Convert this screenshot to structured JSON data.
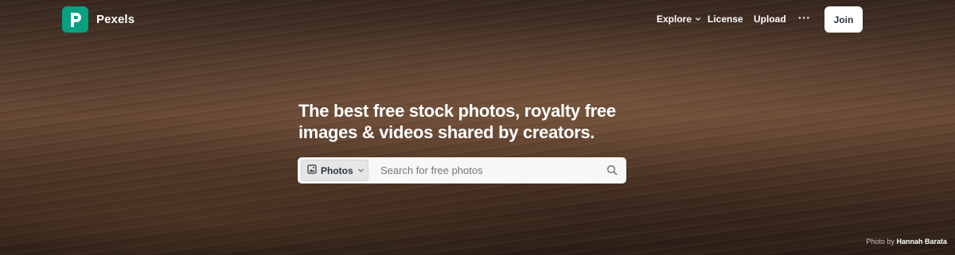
{
  "brand": {
    "name": "Pexels",
    "logo_letter_icon": "pexels-logo-icon",
    "accent": "#07a081"
  },
  "nav": {
    "explore_label": "Explore",
    "license_label": "License",
    "upload_label": "Upload",
    "more_label": "···",
    "join_label": "Join"
  },
  "hero": {
    "headline_line1": "The best free stock photos, royalty free",
    "headline_line2": "images & videos shared by creators."
  },
  "search": {
    "type_label": "Photos",
    "placeholder": "Search for free photos",
    "value": ""
  },
  "credit": {
    "prefix": "Photo by",
    "photographer": "Hannah Barata"
  }
}
